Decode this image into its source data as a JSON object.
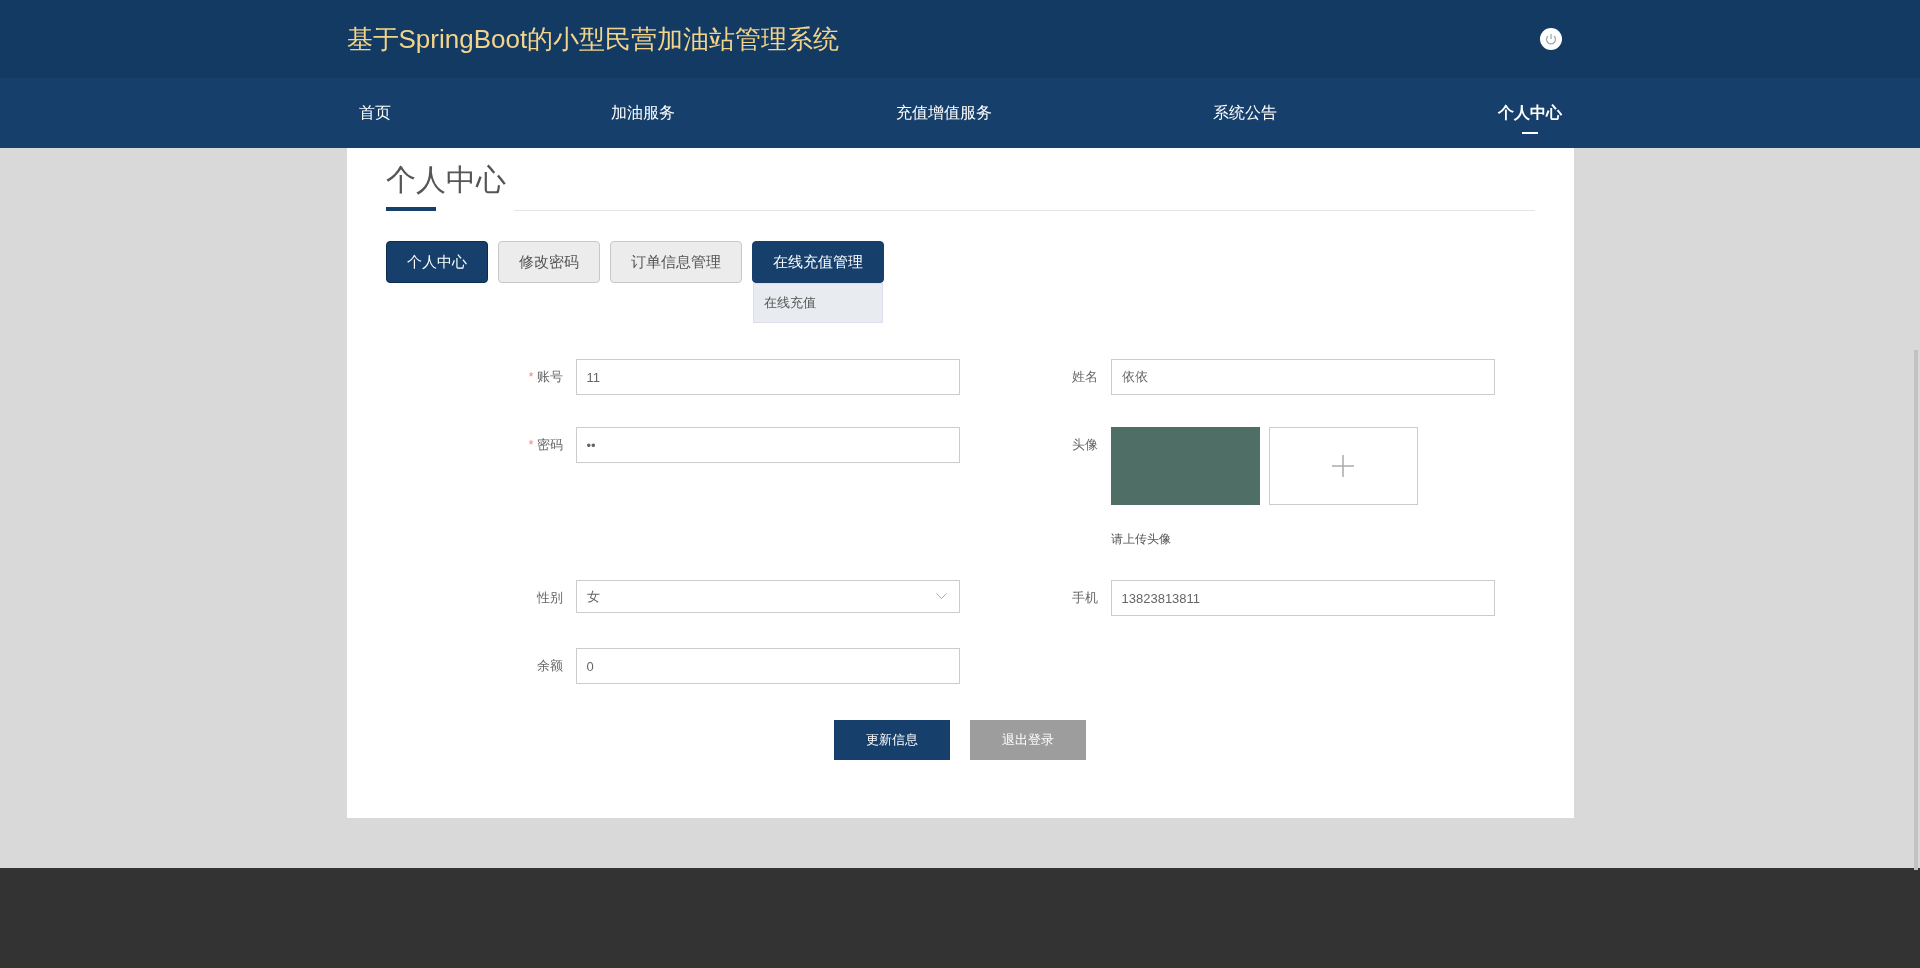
{
  "header": {
    "title": "基于SpringBoot的小型民营加油站管理系统"
  },
  "nav": [
    {
      "label": "首页",
      "selected": false
    },
    {
      "label": "加油服务",
      "selected": false
    },
    {
      "label": "充值增值服务",
      "selected": false
    },
    {
      "label": "系统公告",
      "selected": false
    },
    {
      "label": "个人中心",
      "selected": true
    }
  ],
  "page_title": "个人中心",
  "tabs": [
    {
      "label": "个人中心",
      "selected": true,
      "expanded": false
    },
    {
      "label": "修改密码",
      "selected": false,
      "expanded": false
    },
    {
      "label": "订单信息管理",
      "selected": false,
      "expanded": false
    },
    {
      "label": "在线充值管理",
      "selected": false,
      "expanded": true,
      "menu": [
        "在线充值"
      ]
    }
  ],
  "form": {
    "fields": [
      {
        "kind": "text",
        "label": "账号",
        "required_mark": "*",
        "value": "11"
      },
      {
        "kind": "text",
        "label": "姓名",
        "value": "依依"
      },
      {
        "kind": "text",
        "label": "密码",
        "required_mark": "*",
        "value": "••"
      },
      {
        "kind": "image",
        "label": "头像",
        "hint": "请上传头像"
      },
      {
        "kind": "select",
        "label": "性别",
        "value": "女"
      },
      {
        "kind": "text",
        "label": "手机",
        "value": "13823813811"
      },
      {
        "kind": "text",
        "label": "余额",
        "value": "0"
      }
    ],
    "buttons": [
      {
        "label": "更新信息",
        "kind": "primary"
      },
      {
        "label": "退出登录",
        "kind": "secondary"
      }
    ]
  }
}
